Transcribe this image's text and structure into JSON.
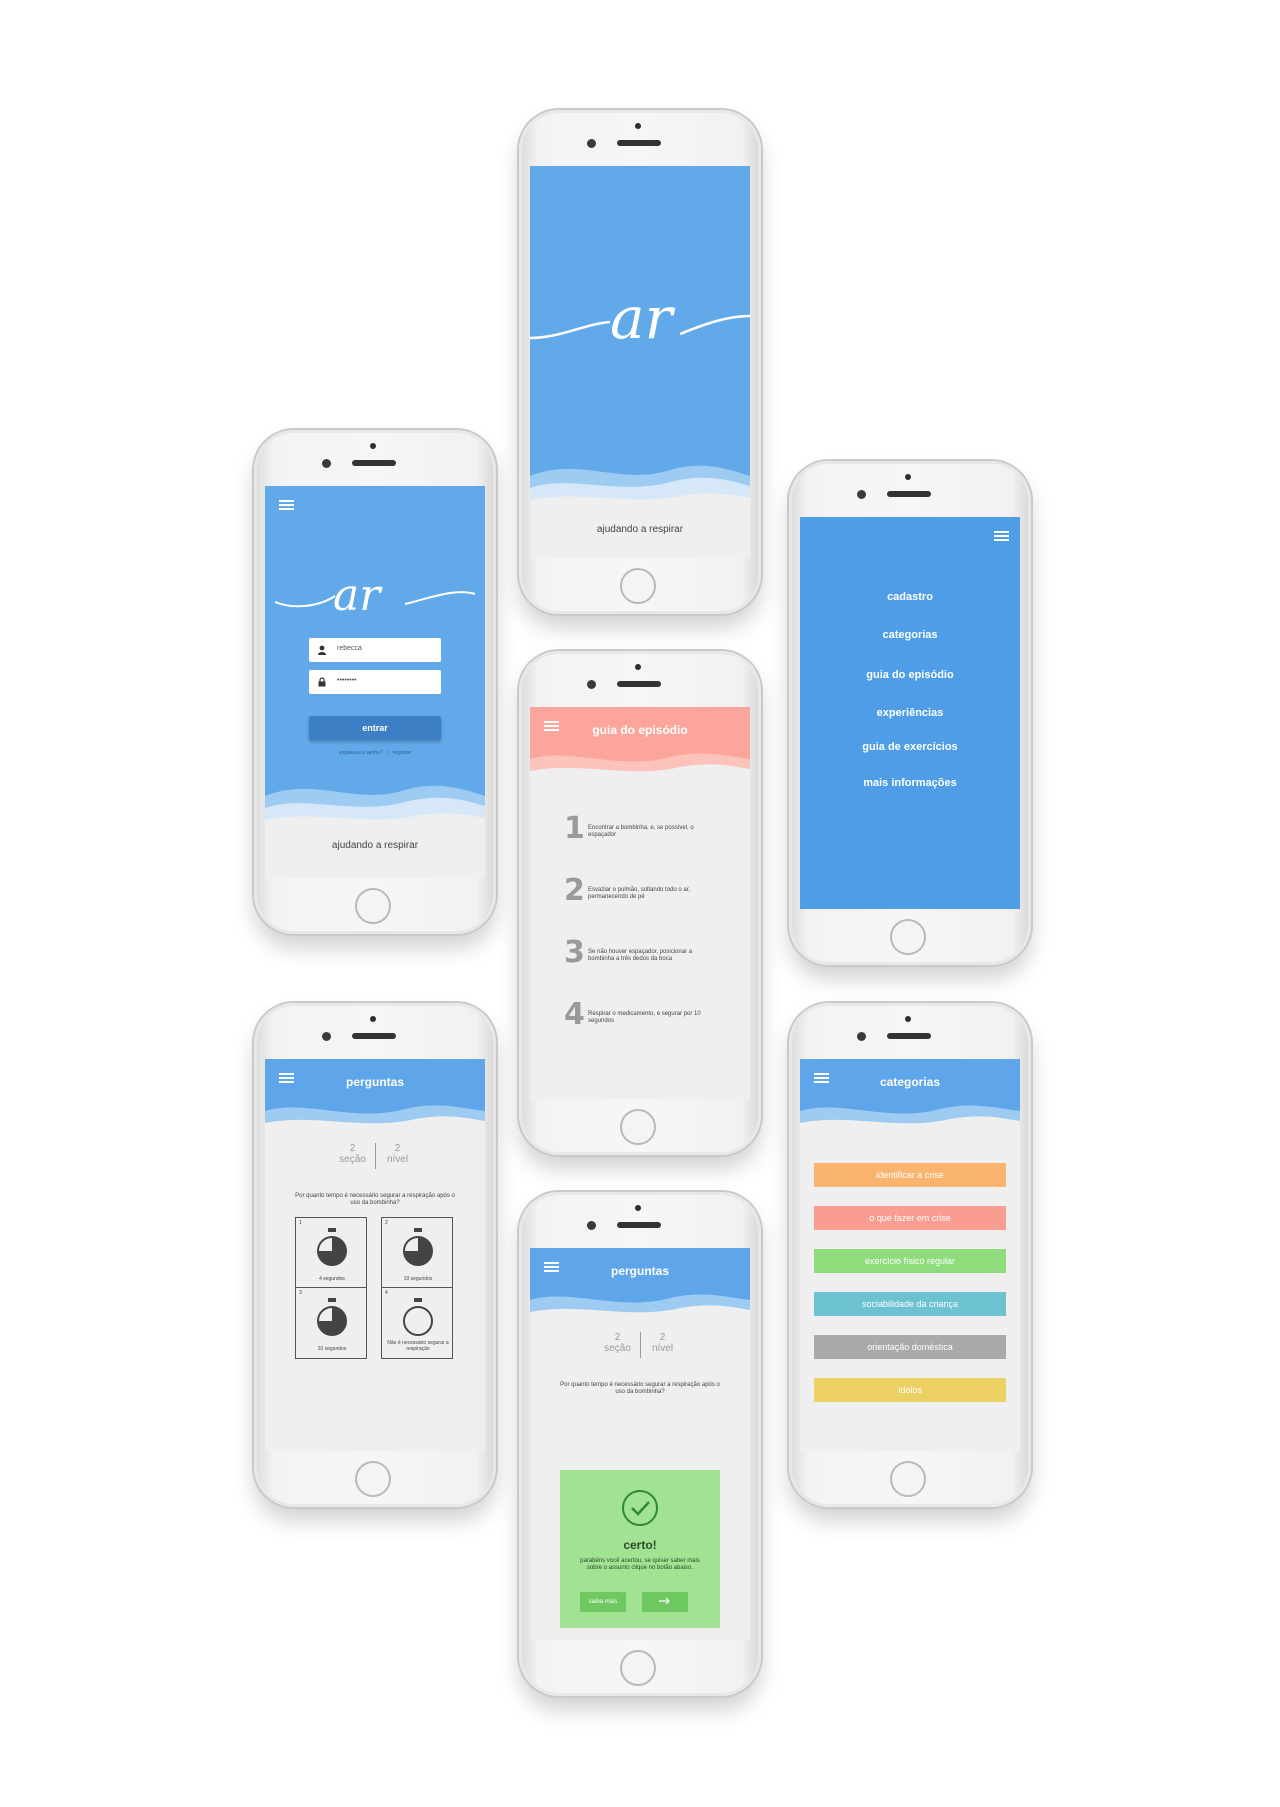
{
  "brand": {
    "logo_text": "ar",
    "tagline": "ajudando a respirar",
    "blue": "#62a9ea",
    "salmon": "#fba59c"
  },
  "login": {
    "username_value": "rebecca",
    "password_value": "••••••••",
    "enter_label": "entrar",
    "forgot_label": "esqueceu a senha?",
    "register_label": "registrar",
    "tagline": "ajudando a respirar"
  },
  "splash": {
    "tagline": "ajudando a respirar"
  },
  "menu": {
    "items": [
      "cadastro",
      "categorias",
      "guia do episódio",
      "experiências",
      "guia de exercícios",
      "mais informações"
    ]
  },
  "guide": {
    "title": "guia do episódio",
    "steps": [
      {
        "num": "1",
        "text": "Encontrar a bombinha, e, se possível, o espaçador"
      },
      {
        "num": "2",
        "text": "Esvaziar o pulmão, soltando todo o ar, permanecendo de pé"
      },
      {
        "num": "3",
        "text": "Se não houver espaçador, posicionar a bombinha a três dedos da boca"
      },
      {
        "num": "4",
        "text": "Respirar o medicamento, e segurar por 10 segundos"
      }
    ]
  },
  "quiz": {
    "title": "perguntas",
    "section_value": "2",
    "section_label": "seção",
    "level_value": "2",
    "level_label": "nível",
    "question": "Por quanto tempo é necessário segurar a respiração após o uso da bombinha?",
    "options": [
      {
        "n": "1",
        "label": "4 segundos"
      },
      {
        "n": "2",
        "label": "10 segundos"
      },
      {
        "n": "3",
        "label": "20 segundos"
      },
      {
        "n": "4",
        "label": "Não é necessário segurar a respiração"
      }
    ]
  },
  "result": {
    "title": "perguntas",
    "section_value": "2",
    "section_label": "seção",
    "level_value": "2",
    "level_label": "nível",
    "question": "Por quanto tempo é necessário segurar a respiração após o uso da bombinha?",
    "feedback_title": "certo!",
    "feedback_text": "parabéns você acertou, se quiser saber mais sobre o assunto clique no botão abaixo.",
    "more_label": "saiba mais",
    "next_icon": "arrow-right-icon"
  },
  "categories": {
    "title": "categorias",
    "items": [
      {
        "label": "identificar a crise",
        "color": "#fbb46e"
      },
      {
        "label": "o que fazer em crise",
        "color": "#f99d90"
      },
      {
        "label": "exercício físico regular",
        "color": "#8fdc7d"
      },
      {
        "label": "sociabilidade da criança",
        "color": "#6cc2d0"
      },
      {
        "label": "orientação doméstica",
        "color": "#a9a9a9"
      },
      {
        "label": "ídolos",
        "color": "#edd064"
      }
    ]
  }
}
